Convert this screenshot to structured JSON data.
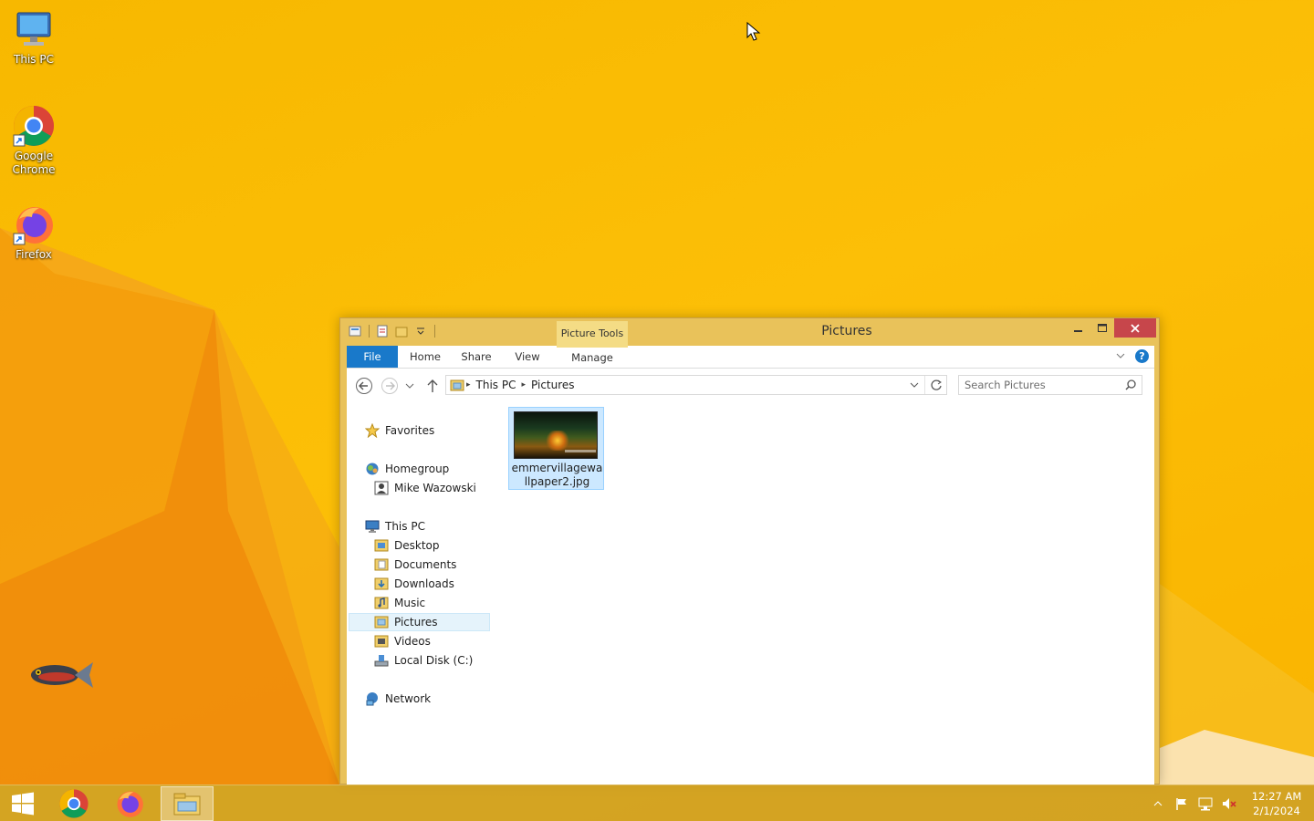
{
  "desktop": {
    "icons": [
      {
        "label": "This PC",
        "icon": "computer-icon"
      },
      {
        "label": "Google Chrome",
        "icon": "chrome-icon"
      },
      {
        "label": "Firefox",
        "icon": "firefox-icon"
      }
    ]
  },
  "window": {
    "title": "Pictures",
    "contextual_tab_group": "Picture Tools",
    "ribbon_tabs": [
      "File",
      "Home",
      "Share",
      "View",
      "Manage"
    ],
    "address": {
      "crumbs": [
        "This PC",
        "Pictures"
      ]
    },
    "search": {
      "placeholder": "Search Pictures"
    },
    "nav": {
      "favorites": "Favorites",
      "homegroup": "Homegroup",
      "homegroup_user": "Mike Wazowski",
      "this_pc": "This PC",
      "this_pc_children": [
        "Desktop",
        "Documents",
        "Downloads",
        "Music",
        "Pictures",
        "Videos",
        "Local Disk (C:)"
      ],
      "selected": "Pictures",
      "network": "Network"
    },
    "files": [
      {
        "name": "emmervillagewallpaper2.jpg",
        "selected": true
      }
    ]
  },
  "taskbar": {
    "pinned": [
      "start-button",
      "chrome",
      "firefox",
      "file-explorer"
    ],
    "active": "file-explorer",
    "clock": {
      "time": "12:27 AM",
      "date": "2/1/2024"
    }
  },
  "colors": {
    "desktop": "#fbbd05",
    "accent": "#1979ca",
    "window_frame": "#e9c25a",
    "close_button": "#c7464b",
    "selection": "#cce8ff"
  }
}
